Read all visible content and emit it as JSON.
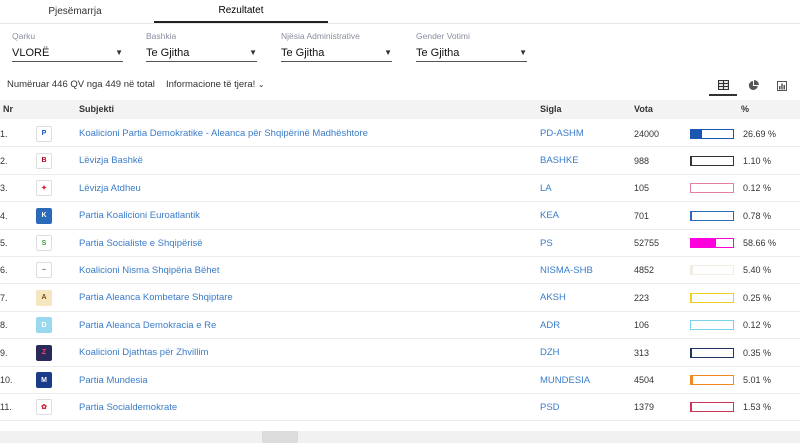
{
  "tabs": [
    {
      "label": "Pjesëmarrja"
    },
    {
      "label": "Rezultatet"
    }
  ],
  "filters": [
    {
      "label": "Qarku",
      "value": "VLORË"
    },
    {
      "label": "Bashkia",
      "value": "Te Gjitha"
    },
    {
      "label": "Njësia Administrative",
      "value": "Te Gjitha"
    },
    {
      "label": "Gender Votimi",
      "value": "Te Gjitha"
    }
  ],
  "info": {
    "counted": "Numëruar 446 QV nga 449 në total",
    "more": "Informacione të tjera!"
  },
  "view_icons": [
    "table-icon",
    "pie-chart-icon",
    "bar-chart-icon"
  ],
  "table": {
    "headers": {
      "nr": "Nr",
      "subject": "Subjekti",
      "sigla": "Sigla",
      "vota": "Vota",
      "pct": "%"
    },
    "rows": [
      {
        "nr": "1.",
        "name": "Koalicioni Partia Demokratike - Aleanca për Shqipërinë Madhështore",
        "sigla": "PD-ASHM",
        "votes": "24000",
        "pct_text": "26.69 %",
        "pct": 26.69,
        "color": "#1a57b0",
        "logo_bg": "#ffffff",
        "logo_fg": "#1a57b0",
        "logo_text": "P"
      },
      {
        "nr": "2.",
        "name": "Lëvizja Bashkë",
        "sigla": "BASHKE",
        "votes": "988",
        "pct_text": "1.10 %",
        "pct": 1.1,
        "color": "#333333",
        "logo_bg": "#ffffff",
        "logo_fg": "#b00020",
        "logo_text": "B"
      },
      {
        "nr": "3.",
        "name": "Lëvizja Atdheu",
        "sigla": "LA",
        "votes": "105",
        "pct_text": "0.12 %",
        "pct": 0.12,
        "color": "#e080a0",
        "logo_bg": "#ffffff",
        "logo_fg": "#cc2233",
        "logo_text": "✦"
      },
      {
        "nr": "4.",
        "name": "Partia Koalicioni Euroatlantik",
        "sigla": "KEA",
        "votes": "701",
        "pct_text": "0.78 %",
        "pct": 0.78,
        "color": "#2a6ab8",
        "logo_bg": "#2a6ab8",
        "logo_fg": "#ffffff",
        "logo_text": "K"
      },
      {
        "nr": "5.",
        "name": "Partia Socialiste e Shqipërisë",
        "sigla": "PS",
        "votes": "52755",
        "pct_text": "58.66 %",
        "pct": 58.66,
        "color": "#ff00dd",
        "logo_bg": "#ffffff",
        "logo_fg": "#3a9a3a",
        "logo_text": "S"
      },
      {
        "nr": "6.",
        "name": "Koalicioni Nisma Shqipëria Bëhet",
        "sigla": "NISMA-SHB",
        "votes": "4852",
        "pct_text": "5.40 %",
        "pct": 5.4,
        "color": "#f3ece2",
        "logo_bg": "#ffffff",
        "logo_fg": "#666666",
        "logo_text": "~"
      },
      {
        "nr": "7.",
        "name": "Partia Aleanca Kombetare Shqiptare",
        "sigla": "AKSH",
        "votes": "223",
        "pct_text": "0.25 %",
        "pct": 0.25,
        "color": "#f0d020",
        "logo_bg": "#f6e6c0",
        "logo_fg": "#7a4a10",
        "logo_text": "A"
      },
      {
        "nr": "8.",
        "name": "Partia Aleanca Demokracia e Re",
        "sigla": "ADR",
        "votes": "106",
        "pct_text": "0.12 %",
        "pct": 0.12,
        "color": "#7ad0e8",
        "logo_bg": "#9ad8ee",
        "logo_fg": "#ffffff",
        "logo_text": "D"
      },
      {
        "nr": "9.",
        "name": "Koalicioni Djathtas për Zhvillim",
        "sigla": "DZH",
        "votes": "313",
        "pct_text": "0.35 %",
        "pct": 0.35,
        "color": "#223366",
        "logo_bg": "#2a2a5a",
        "logo_fg": "#ff4466",
        "logo_text": "Z"
      },
      {
        "nr": "10.",
        "name": "Partia Mundesia",
        "sigla": "MUNDESIA",
        "votes": "4504",
        "pct_text": "5.01 %",
        "pct": 5.01,
        "color": "#f08a20",
        "logo_bg": "#1a3a8a",
        "logo_fg": "#ffffff",
        "logo_text": "M"
      },
      {
        "nr": "11.",
        "name": "Partia Socialdemokrate",
        "sigla": "PSD",
        "votes": "1379",
        "pct_text": "1.53 %",
        "pct": 1.53,
        "color": "#cc3355",
        "logo_bg": "#ffffff",
        "logo_fg": "#cc2233",
        "logo_text": "✿"
      }
    ]
  }
}
